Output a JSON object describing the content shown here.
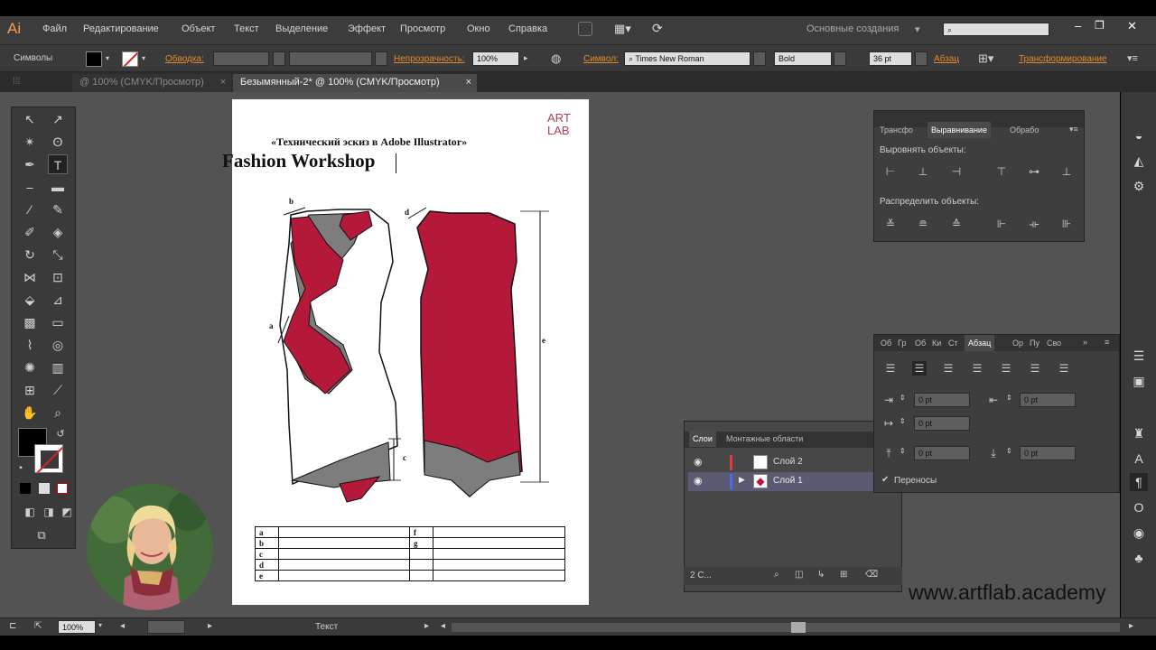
{
  "app": {
    "logo": "Ai"
  },
  "menu": [
    "Файл",
    "Редактирование",
    "Объект",
    "Текст",
    "Выделение",
    "Эффект",
    "Просмотр",
    "Окно",
    "Справка"
  ],
  "workspace_label": "Основные создания",
  "search_placeholder": "",
  "control": {
    "mode_label": "Символы",
    "stroke_label": "Обводка:",
    "opacity_label": "Непрозрачность:",
    "opacity_value": "100%",
    "font_label": "Символ:",
    "font_name": "Times New Roman",
    "font_style": "Bold",
    "font_size": "36 pt",
    "paragraph_label": "Абзац",
    "transform_label": "Трансформирование"
  },
  "tabs": [
    {
      "label": "@ 100% (CMYK/Просмотр)",
      "active": false
    },
    {
      "label": "Безымянный-2* @ 100% (CMYK/Просмотр)",
      "active": true
    }
  ],
  "document": {
    "title": "«Технический эскиз в Adobe Illustrator»",
    "heading": "Fashion Workshop",
    "logo_line1": "ART",
    "logo_line2": "LAB",
    "measure_labels": {
      "b": "b",
      "d": "d",
      "a": "a",
      "e": "e",
      "c": "c"
    },
    "table": [
      [
        "a",
        "",
        "f",
        ""
      ],
      [
        "b",
        "",
        "g",
        ""
      ],
      [
        "c",
        "",
        "",
        ""
      ],
      [
        "d",
        "",
        "",
        ""
      ],
      [
        "e",
        "",
        "",
        ""
      ]
    ]
  },
  "align_panel": {
    "tabs": [
      "Трансфо",
      "Выравнивание",
      "Обрабо"
    ],
    "align_objects": "Выровнять объекты:",
    "distribute_objects": "Распределить объекты:"
  },
  "paragraph_panel": {
    "tabs": [
      "Об",
      "Гр",
      "Об",
      "Ки",
      "Ст",
      "Абзац",
      "Ор",
      "Пу",
      "Сво"
    ],
    "fields": [
      "0 pt",
      "0 pt",
      "0 pt",
      "0 pt",
      "0 pt"
    ],
    "hyphenate": "Переносы"
  },
  "layers_panel": {
    "tabs": [
      "Слои",
      "Монтажные области"
    ],
    "layers": [
      {
        "name": "Слой 2",
        "color": "#e03a4a"
      },
      {
        "name": "Слой 1",
        "color": "#4a6ee0"
      }
    ],
    "count": "2 С..."
  },
  "status": {
    "zoom": "100%",
    "tool": "Текст"
  },
  "watermark": "www.artflab.academy",
  "colors": {
    "garment_red": "#b5193a",
    "garment_gray": "#7d7d7d",
    "ui_dark": "#3c3c3c",
    "canvas": "#535353"
  }
}
